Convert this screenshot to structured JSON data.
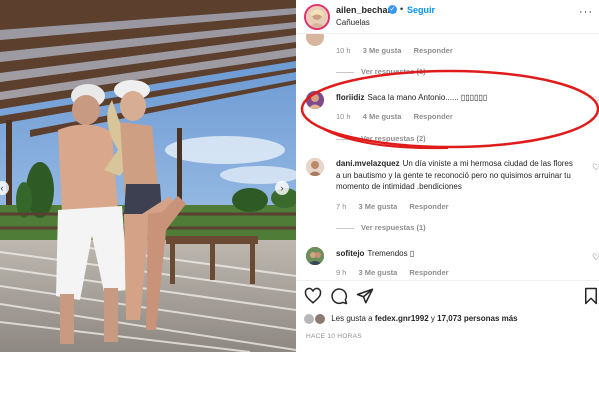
{
  "header": {
    "username": "ailen_bechara",
    "verified_mark": "✓",
    "dot": "•",
    "follow_label": "Seguir",
    "location": "Cañuelas",
    "more": "···"
  },
  "comments": [
    {
      "id": "c0",
      "time": "10 h",
      "likes": "3 Me gusta",
      "reply": "Responder",
      "replies": "Ver respuestas (1)"
    },
    {
      "id": "c1",
      "user": "floriidiz",
      "text": "Saca la mano Antonio...... ▯▯▯▯▯▯",
      "time": "10 h",
      "likes": "4 Me gusta",
      "reply": "Responder",
      "replies": "Ver respuestas (2)"
    },
    {
      "id": "c2",
      "user": "dani.mvelazquez",
      "text": "Un día viniste a mi hermosa ciudad de las flores a un bautismo y la gente te reconoció pero no quisimos arruinar tu momento de intimidad .bendiciones",
      "time": "7 h",
      "likes": "3 Me gusta",
      "reply": "Responder",
      "replies": "Ver respuestas (1)"
    },
    {
      "id": "c3",
      "user": "sofitejo",
      "text": "Tremendos ▯",
      "time": "9 h",
      "likes": "3 Me gusta",
      "reply": "Responder"
    }
  ],
  "footer": {
    "likes_prefix": "Les gusta a",
    "likes_user": "fedex.gnr1992",
    "likes_joiner": "y",
    "likes_count": "17,073 personas más",
    "time_ago": "HACE 10 HORAS"
  },
  "colors": {
    "follow": "#0095f6",
    "verified": "#3897f0",
    "annotation": "#e01b1b"
  },
  "icons": [
    "chevron-left-icon",
    "chevron-right-icon",
    "heart-icon",
    "comment-icon",
    "share-icon",
    "bookmark-icon",
    "verified-icon",
    "more-icon"
  ]
}
